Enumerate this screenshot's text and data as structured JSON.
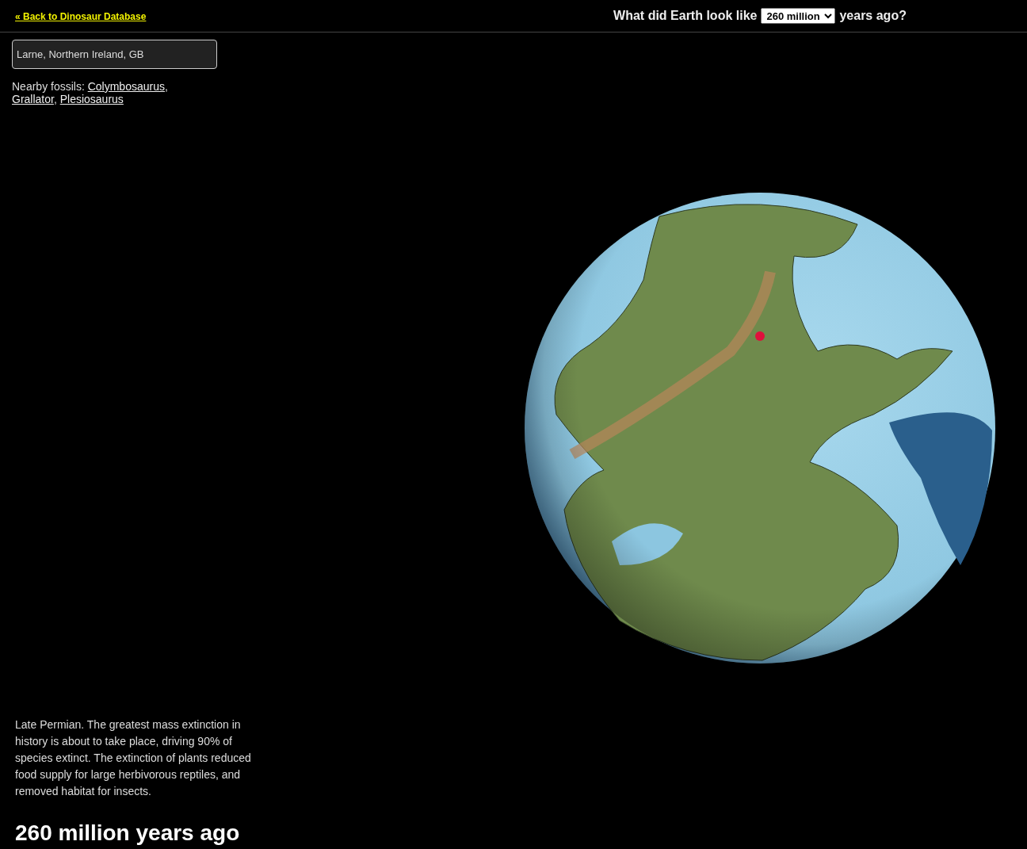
{
  "header": {
    "back_link": "« Back to Dinosaur Database",
    "question_prefix": "What did Earth look like",
    "age_select": "260 million",
    "question_suffix": "years ago?"
  },
  "sidebar": {
    "location_field": "Larne, Northern Ireland, GB",
    "nearby_label": "Nearby fossils:",
    "fossils": [
      "Colymbosaurus",
      "Grallator",
      "Plesiosaurus"
    ],
    "fossil_separator": ",",
    "description": "Late Permian. The greatest mass extinction in history is about to take place, driving 90% of species extinct. The extinction of plants reduced food supply for large herbivorous reptiles, and removed habitat for insects.",
    "age_heading": "260 million years ago"
  }
}
